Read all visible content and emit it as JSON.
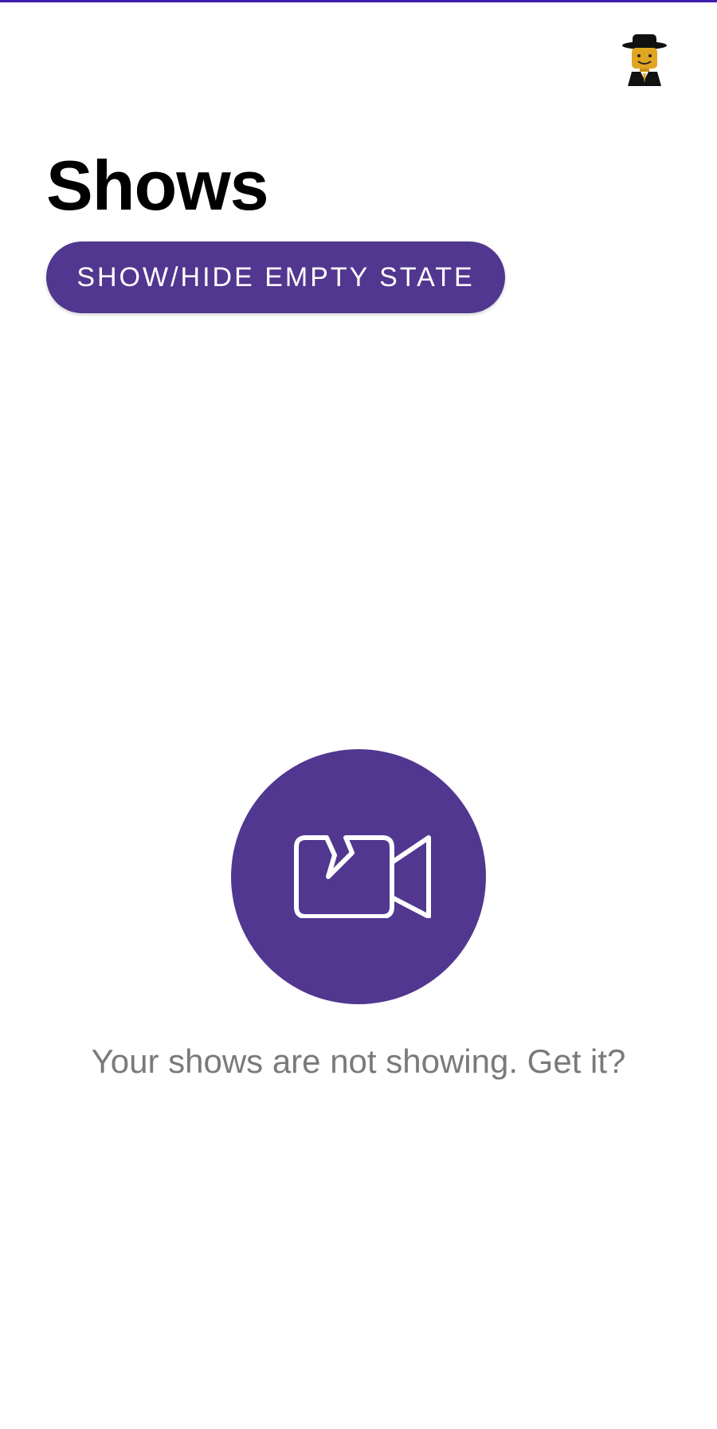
{
  "header": {
    "avatar_icon": "lego-minifigure-avatar-icon"
  },
  "page": {
    "title": "Shows"
  },
  "actions": {
    "toggle_label": "SHOW/HIDE EMPTY STATE"
  },
  "empty_state": {
    "icon": "broken-video-camera-icon",
    "message": "Your shows are not showing. Get it?"
  },
  "colors": {
    "accent": "#51378f",
    "status_bar_line": "#3f1fb0",
    "message_text": "#7a7a7a",
    "title_text": "#000000"
  }
}
